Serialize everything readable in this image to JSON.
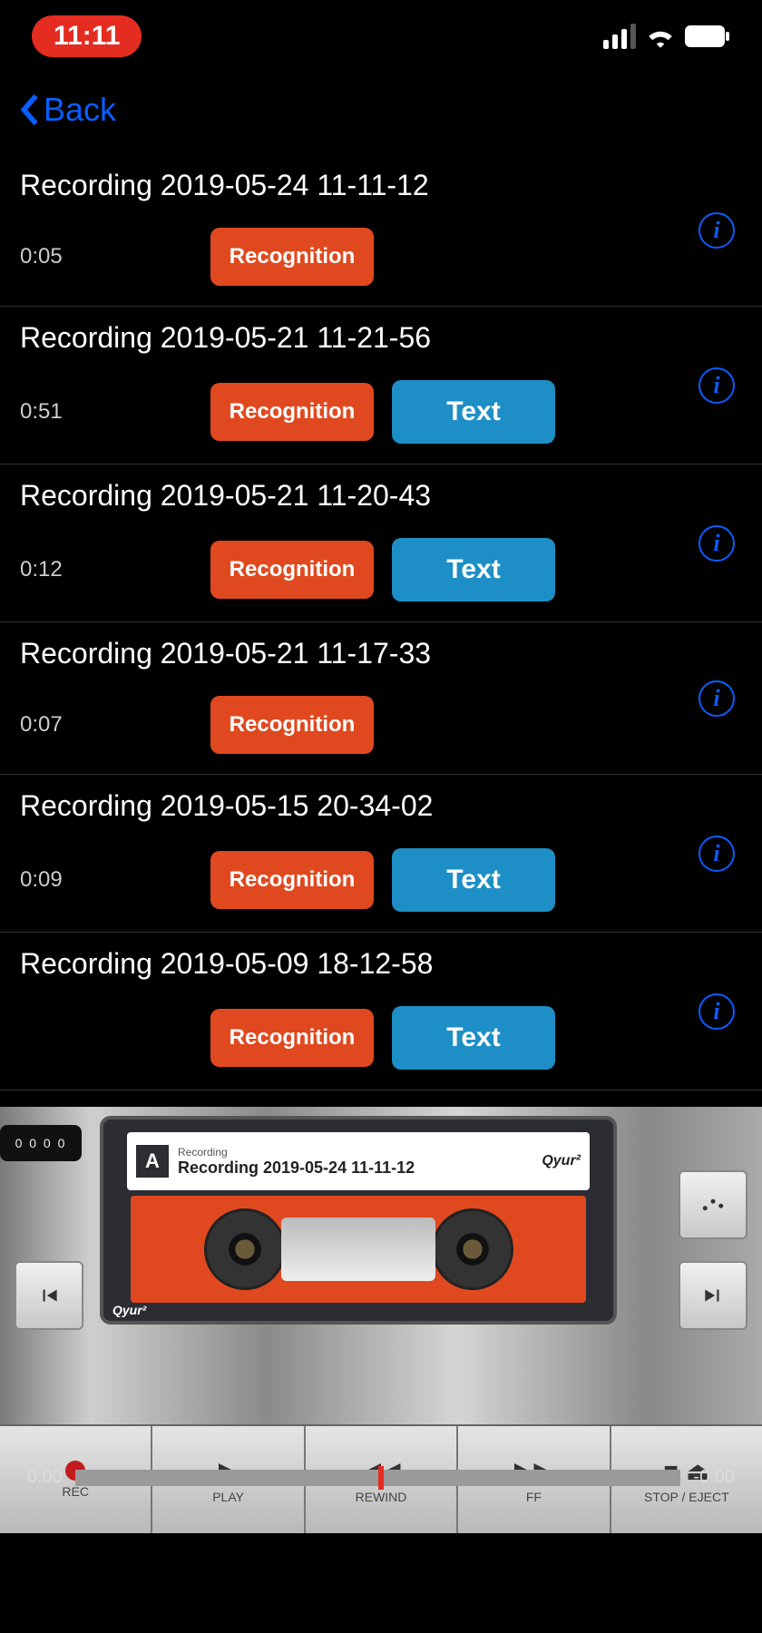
{
  "status": {
    "time": "11:11"
  },
  "nav": {
    "back": "Back"
  },
  "recordings": [
    {
      "title": "Recording 2019-05-24 11-11-12",
      "duration": "0:05",
      "recognition": "Recognition",
      "text": null
    },
    {
      "title": "Recording 2019-05-21 11-21-56",
      "duration": "0:51",
      "recognition": "Recognition",
      "text": "Text"
    },
    {
      "title": "Recording 2019-05-21 11-20-43",
      "duration": "0:12",
      "recognition": "Recognition",
      "text": "Text"
    },
    {
      "title": "Recording 2019-05-21 11-17-33",
      "duration": "0:07",
      "recognition": "Recognition",
      "text": null
    },
    {
      "title": "Recording 2019-05-15 20-34-02",
      "duration": "0:09",
      "recognition": "Recognition",
      "text": "Text"
    },
    {
      "title": "Recording 2019-05-09 18-12-58",
      "duration": "",
      "recognition": "Recognition",
      "text": "Text"
    }
  ],
  "cassette": {
    "side": "A",
    "subtitle": "Recording",
    "title": "Recording 2019-05-24 11-11-12",
    "brand": "Qyur²",
    "logo": "Qyur²"
  },
  "counter": "0 0 0 0",
  "timeline": {
    "current": "0:00",
    "remaining": "-0:00"
  },
  "controls": {
    "rec": "REC",
    "play": "PLAY",
    "rewind": "REWIND",
    "ff": "FF",
    "stop": "STOP / EJECT"
  },
  "side_buttons": {
    "prev": "Prev",
    "next": "Next"
  }
}
